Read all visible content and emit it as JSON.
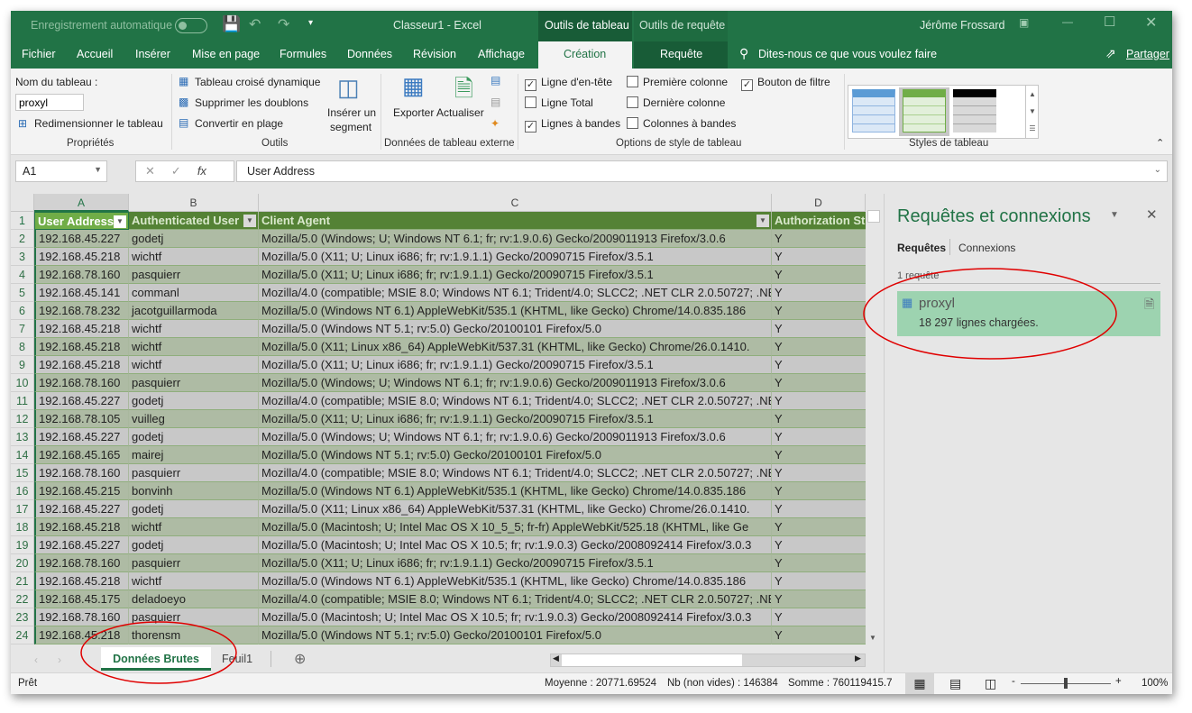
{
  "titlebar": {
    "autosave": "Enregistrement automatique",
    "title": "Classeur1  -  Excel",
    "context_table": "Outils de tableau",
    "context_query": "Outils de requête",
    "user": "Jérôme Frossard"
  },
  "tabs": [
    "Fichier",
    "Accueil",
    "Insérer",
    "Mise en page",
    "Formules",
    "Données",
    "Révision",
    "Affichage",
    "Création",
    "Requête"
  ],
  "active_tab": "Création",
  "tellme": "Dites-nous ce que vous voulez faire",
  "share": "Partager",
  "ribbon": {
    "props": {
      "name_label": "Nom du tableau :",
      "name_value": "proxyl",
      "resize": "Redimensionner le tableau",
      "group": "Propriétés"
    },
    "tools": {
      "pivot": "Tableau croisé dynamique",
      "dedupe": "Supprimer les doublons",
      "convert": "Convertir en plage",
      "slicer1": "Insérer un",
      "slicer2": "segment",
      "group": "Outils"
    },
    "external": {
      "export": "Exporter",
      "refresh": "Actualiser",
      "group": "Données de tableau externe"
    },
    "style_opts": {
      "header_row": "Ligne d'en-tête",
      "total_row": "Ligne Total",
      "banded_rows": "Lignes à bandes",
      "first_col": "Première colonne",
      "last_col": "Dernière colonne",
      "banded_cols": "Colonnes à bandes",
      "filter_btn": "Bouton de filtre",
      "group": "Options de style de tableau",
      "checked": {
        "header_row": true,
        "total_row": false,
        "banded_rows": true,
        "first_col": false,
        "last_col": false,
        "banded_cols": false,
        "filter_btn": true
      }
    },
    "styles": {
      "group": "Styles de tableau",
      "selected": "green"
    }
  },
  "formula": {
    "namebox": "A1",
    "fx": "fx",
    "value": "User Address"
  },
  "columns": [
    "A",
    "B",
    "C",
    "D"
  ],
  "headers": [
    "User Address",
    "Authenticated User",
    "Client Agent",
    "Authorization St"
  ],
  "rows": [
    [
      "192.168.45.227",
      "godetj",
      "Mozilla/5.0 (Windows; U; Windows NT 6.1; fr; rv:1.9.0.6) Gecko/2009011913 Firefox/3.0.6",
      "Y"
    ],
    [
      "192.168.45.218",
      "wichtf",
      "Mozilla/5.0 (X11; U; Linux i686; fr; rv:1.9.1.1) Gecko/20090715 Firefox/3.5.1",
      "Y"
    ],
    [
      "192.168.78.160",
      "pasquierr",
      "Mozilla/5.0 (X11; U; Linux i686; fr; rv:1.9.1.1) Gecko/20090715 Firefox/3.5.1",
      "Y"
    ],
    [
      "192.168.45.141",
      "commanl",
      "Mozilla/4.0 (compatible; MSIE 8.0; Windows NT 6.1; Trident/4.0; SLCC2; .NET CLR 2.0.50727; .NET",
      "Y"
    ],
    [
      "192.168.78.232",
      "jacotguillarmoda",
      "Mozilla/5.0 (Windows NT 6.1) AppleWebKit/535.1 (KHTML, like Gecko) Chrome/14.0.835.186",
      "Y"
    ],
    [
      "192.168.45.218",
      "wichtf",
      "Mozilla/5.0 (Windows NT 5.1; rv:5.0) Gecko/20100101 Firefox/5.0",
      "Y"
    ],
    [
      "192.168.45.218",
      "wichtf",
      "Mozilla/5.0 (X11; Linux x86_64) AppleWebKit/537.31 (KHTML, like Gecko) Chrome/26.0.1410.",
      "Y"
    ],
    [
      "192.168.45.218",
      "wichtf",
      "Mozilla/5.0 (X11; U; Linux i686; fr; rv:1.9.1.1) Gecko/20090715 Firefox/3.5.1",
      "Y"
    ],
    [
      "192.168.78.160",
      "pasquierr",
      "Mozilla/5.0 (Windows; U; Windows NT 6.1; fr; rv:1.9.0.6) Gecko/2009011913 Firefox/3.0.6",
      "Y"
    ],
    [
      "192.168.45.227",
      "godetj",
      "Mozilla/4.0 (compatible; MSIE 8.0; Windows NT 6.1; Trident/4.0; SLCC2; .NET CLR 2.0.50727; .NET",
      "Y"
    ],
    [
      "192.168.78.105",
      "vuilleg",
      "Mozilla/5.0 (X11; U; Linux i686; fr; rv:1.9.1.1) Gecko/20090715 Firefox/3.5.1",
      "Y"
    ],
    [
      "192.168.45.227",
      "godetj",
      "Mozilla/5.0 (Windows; U; Windows NT 6.1; fr; rv:1.9.0.6) Gecko/2009011913 Firefox/3.0.6",
      "Y"
    ],
    [
      "192.168.45.165",
      "mairej",
      "Mozilla/5.0 (Windows NT 5.1; rv:5.0) Gecko/20100101 Firefox/5.0",
      "Y"
    ],
    [
      "192.168.78.160",
      "pasquierr",
      "Mozilla/4.0 (compatible; MSIE 8.0; Windows NT 6.1; Trident/4.0; SLCC2; .NET CLR 2.0.50727; .NET",
      "Y"
    ],
    [
      "192.168.45.215",
      "bonvinh",
      "Mozilla/5.0 (Windows NT 6.1) AppleWebKit/535.1 (KHTML, like Gecko) Chrome/14.0.835.186",
      "Y"
    ],
    [
      "192.168.45.227",
      "godetj",
      "Mozilla/5.0 (X11; Linux x86_64) AppleWebKit/537.31 (KHTML, like Gecko) Chrome/26.0.1410.",
      "Y"
    ],
    [
      "192.168.45.218",
      "wichtf",
      "Mozilla/5.0 (Macintosh; U; Intel Mac OS X 10_5_5; fr-fr) AppleWebKit/525.18 (KHTML, like Ge",
      "Y"
    ],
    [
      "192.168.45.227",
      "godetj",
      "Mozilla/5.0 (Macintosh; U; Intel Mac OS X 10.5; fr; rv:1.9.0.3) Gecko/2008092414 Firefox/3.0.3",
      "Y"
    ],
    [
      "192.168.78.160",
      "pasquierr",
      "Mozilla/5.0 (X11; U; Linux i686; fr; rv:1.9.1.1) Gecko/20090715 Firefox/3.5.1",
      "Y"
    ],
    [
      "192.168.45.218",
      "wichtf",
      "Mozilla/5.0 (Windows NT 6.1) AppleWebKit/535.1 (KHTML, like Gecko) Chrome/14.0.835.186",
      "Y"
    ],
    [
      "192.168.45.175",
      "deladoeyo",
      "Mozilla/4.0 (compatible; MSIE 8.0; Windows NT 6.1; Trident/4.0; SLCC2; .NET CLR 2.0.50727; .NET",
      "Y"
    ],
    [
      "192.168.78.160",
      "pasquierr",
      "Mozilla/5.0 (Macintosh; U; Intel Mac OS X 10.5; fr; rv:1.9.0.3) Gecko/2008092414 Firefox/3.0.3",
      "Y"
    ],
    [
      "192.168.45.218",
      "thorensm",
      "Mozilla/5.0 (Windows NT 5.1; rv:5.0) Gecko/20100101 Firefox/5.0",
      "Y"
    ]
  ],
  "sheets": [
    "Données Brutes",
    "Feuil1"
  ],
  "active_sheet": "Données Brutes",
  "pane": {
    "title": "Requêtes et connexions",
    "tab_queries": "Requêtes",
    "tab_connections": "Connexions",
    "count": "1 requête",
    "query_name": "proxyl",
    "query_status": "18 297 lignes chargées."
  },
  "status": {
    "ready": "Prêt",
    "average": "Moyenne : 20771.69524",
    "count": "Nb (non vides) : 146384",
    "sum": "Somme : 760119415.7",
    "zoom": "100%",
    "zoom_level": 100
  },
  "colors": {
    "excel_green": "#217346",
    "header_green": "#548235",
    "band_green": "#aebba4",
    "band_gray": "#c8c8c8",
    "query_highlight": "#9dd3b0",
    "annotation": "#e00000"
  }
}
